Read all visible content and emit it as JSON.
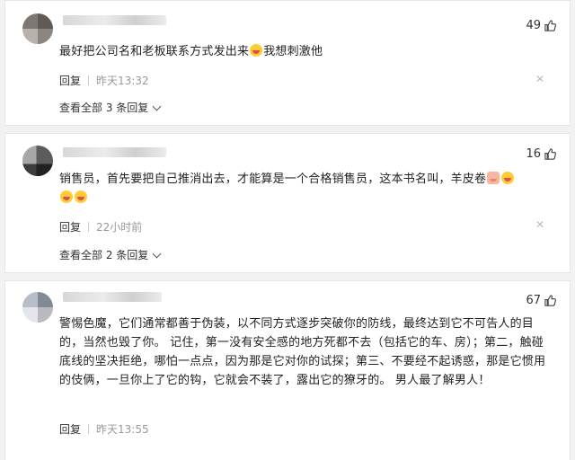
{
  "comments": [
    {
      "likes": "49",
      "text": "最好把公司名和老板联系方式发出来",
      "text_tail": "我想刺激他",
      "reply_label": "回复",
      "time": "昨天13:32",
      "view_all": "查看全部 3 条回复"
    },
    {
      "likes": "16",
      "text": "销售员，首先要把自己推消出去，才能算是一个合格销售员，这本书名叫，羊皮卷",
      "reply_label": "回复",
      "time": "22小时前",
      "view_all": "查看全部 2 条回复"
    },
    {
      "likes": "67",
      "text": "警惕色魔，它们通常都善于伪装，以不同方式逐步突破你的防线，最终达到它不可告人的目的，当然也毁了你。 记住，第一没有安全感的地方死都不去（包括它的车、房）；第二，触碰底线的坚决拒绝，哪怕一点点，因为那是它对你的试探；第三、不要经不起诱惑，那是它惯用的伎俩，一旦你上了它的钩，它就会不装了，露出它的獠牙的。 男人最了解男人！",
      "reply_label": "回复",
      "time": "昨天13:55"
    }
  ],
  "icons": {
    "like": "thumbs-up-icon",
    "close": "close-icon",
    "expand": "chevron-down-icon"
  },
  "colors": {
    "text": "#222222",
    "muted": "#999999",
    "background": "#f2f2f2"
  }
}
